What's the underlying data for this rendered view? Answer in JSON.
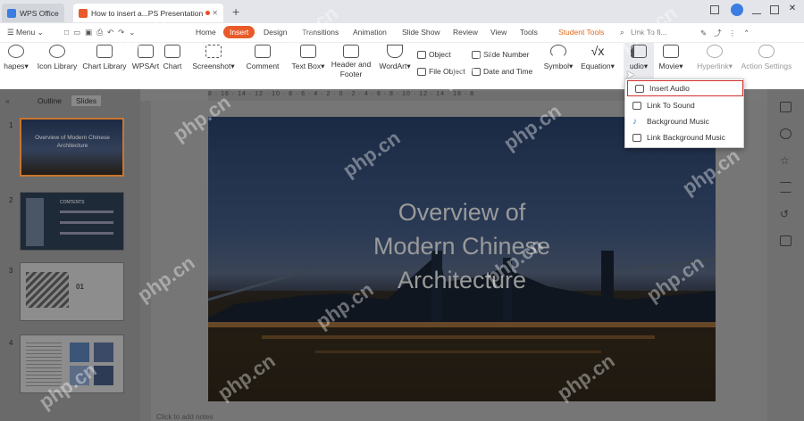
{
  "titlebar": {
    "tab_wps": "WPS Office",
    "tab_doc": "How to insert a...PS Presentation",
    "add_tab": "+"
  },
  "menubar": {
    "menu_label": "Menu",
    "tabs": [
      "Home",
      "Insert",
      "Design",
      "Transitions",
      "Animation",
      "Slide Show",
      "Review",
      "View",
      "Tools",
      "Student Tools"
    ],
    "search_placeholder": "Link To fi..."
  },
  "ribbon": {
    "shapes": "hapes",
    "icon_library": "Icon Library",
    "chart_library": "Chart Library",
    "wpsart": "WPSArt",
    "chart": "Chart",
    "screenshot": "Screenshot",
    "comment": "Comment",
    "text_box": "Text Box",
    "header_footer_1": "Header and",
    "header_footer_2": "Footer",
    "wordart": "WordArt",
    "object": "Object",
    "file_object": "File Object",
    "slide_number": "Slide Number",
    "date_time": "Date and Time",
    "symbol": "Symbol",
    "equation": "Equation",
    "audio": "udio",
    "movie": "Movie",
    "hyperlink": "Hyperlink",
    "action_settings": "Action Settings"
  },
  "ruler": {
    "ticks": "8 · 16 · 14 · 12 · 10 · 8 · 6 · 4 · 2 · 0 · 2 · 4 · 6 · 8 · 10 · 12 · 14 · 16 · 8"
  },
  "leftpane": {
    "tab_outline": "Outline",
    "tab_slides": "Slides",
    "slides": [
      {
        "num": "1",
        "text": "Overview of Modern Chinese Architecture"
      },
      {
        "num": "2",
        "text": "CONTENTS"
      },
      {
        "num": "3",
        "text": "01"
      },
      {
        "num": "4",
        "text": ""
      }
    ],
    "notes_hint": "Click to add notes"
  },
  "slide": {
    "title_line1": "Overview of",
    "title_line2": "Modern Chinese",
    "title_line3": "Architecture"
  },
  "audio_menu": {
    "items": [
      "Insert Audio",
      "Link To Sound",
      "Background Music",
      "Link Background Music"
    ]
  },
  "watermark": "php.cn",
  "colors": {
    "accent": "#e95a2a",
    "highlight_border": "#d0312d",
    "student_tools": "#e2691a"
  }
}
